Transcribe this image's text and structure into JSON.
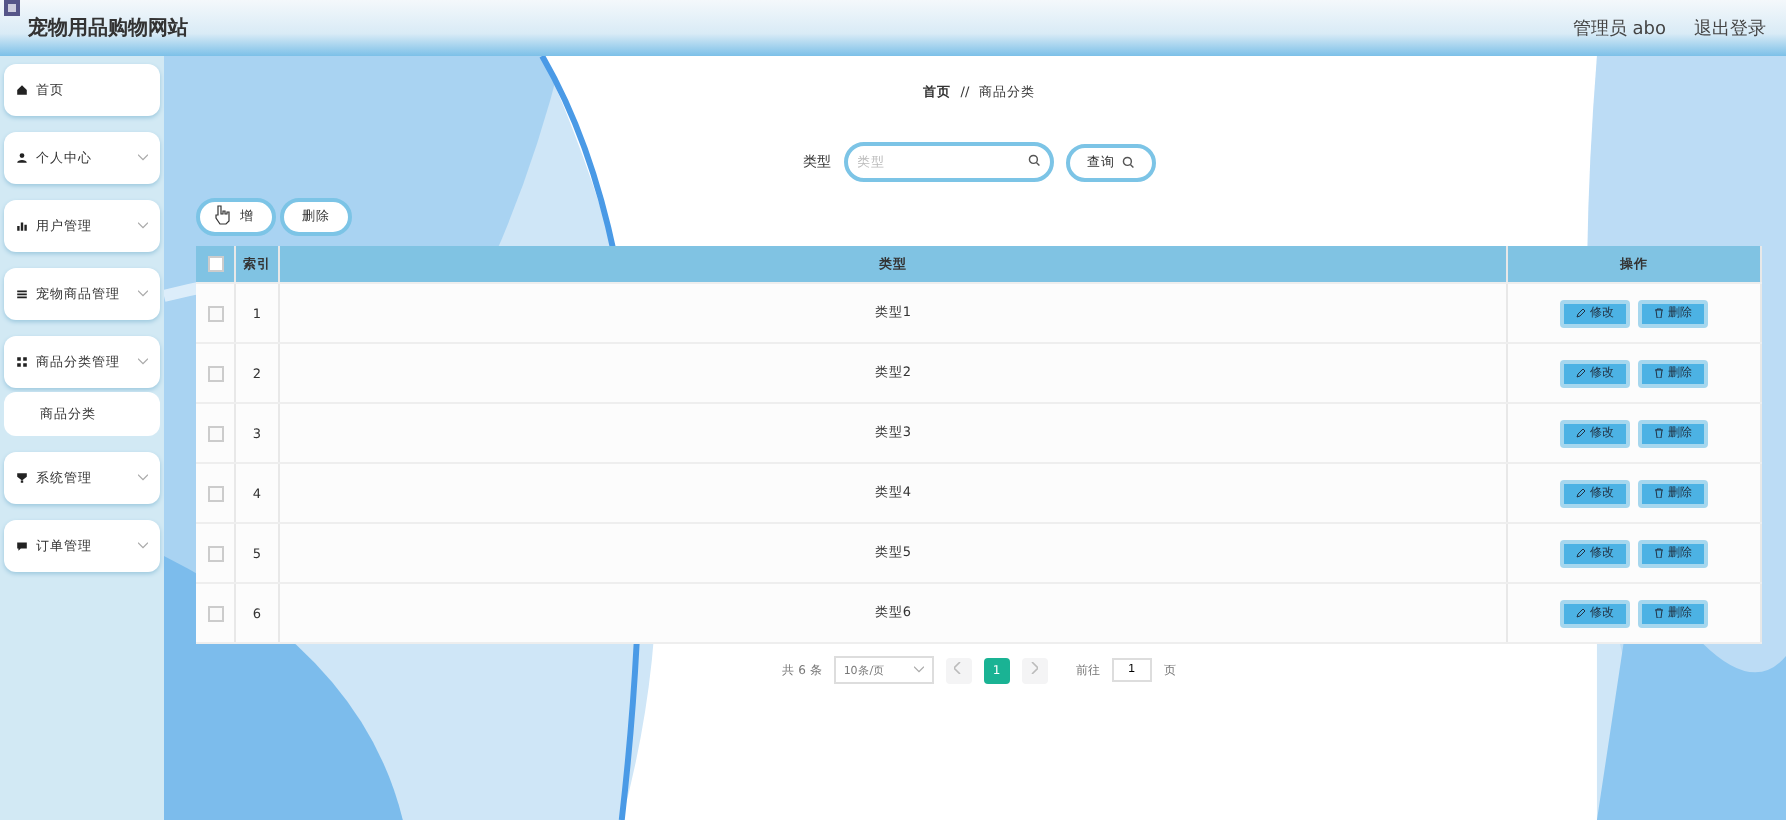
{
  "header": {
    "title": "宠物用品购物网站",
    "user": "管理员 abo",
    "logout": "退出登录"
  },
  "sidebar": {
    "items": [
      {
        "label": "首页",
        "expandable": false
      },
      {
        "label": "个人中心",
        "expandable": true
      },
      {
        "label": "用户管理",
        "expandable": true
      },
      {
        "label": "宠物商品管理",
        "expandable": true
      },
      {
        "label": "商品分类管理",
        "expandable": true,
        "children": [
          {
            "label": "商品分类"
          }
        ]
      },
      {
        "label": "系统管理",
        "expandable": true
      },
      {
        "label": "订单管理",
        "expandable": true
      }
    ]
  },
  "breadcrumb": {
    "home": "首页",
    "separator": "//",
    "current": "商品分类"
  },
  "search": {
    "label": "类型",
    "placeholder": "类型",
    "button": "查询"
  },
  "actions": [
    "增",
    "删除"
  ],
  "table": {
    "columns": [
      "索引",
      "类型",
      "操作"
    ],
    "all_checked": false,
    "rows": [
      {
        "index": "1",
        "type": "类型1",
        "checked": false,
        "edit": "修改",
        "delete": "删除"
      },
      {
        "index": "2",
        "type": "类型2",
        "checked": false,
        "edit": "修改",
        "delete": "删除"
      },
      {
        "index": "3",
        "type": "类型3",
        "checked": false,
        "edit": "修改",
        "delete": "删除"
      },
      {
        "index": "4",
        "type": "类型4",
        "checked": false,
        "edit": "修改",
        "delete": "删除"
      },
      {
        "index": "5",
        "type": "类型5",
        "checked": false,
        "edit": "修改",
        "delete": "删除"
      },
      {
        "index": "6",
        "type": "类型6",
        "checked": false,
        "edit": "修改",
        "delete": "删除"
      }
    ]
  },
  "pagination": {
    "total": "共 6 条",
    "page_size": "10条/页",
    "pages": [
      {
        "label": "1",
        "selected": true
      }
    ],
    "goto": "前往",
    "goto_value": "1",
    "page_unit": "页"
  }
}
